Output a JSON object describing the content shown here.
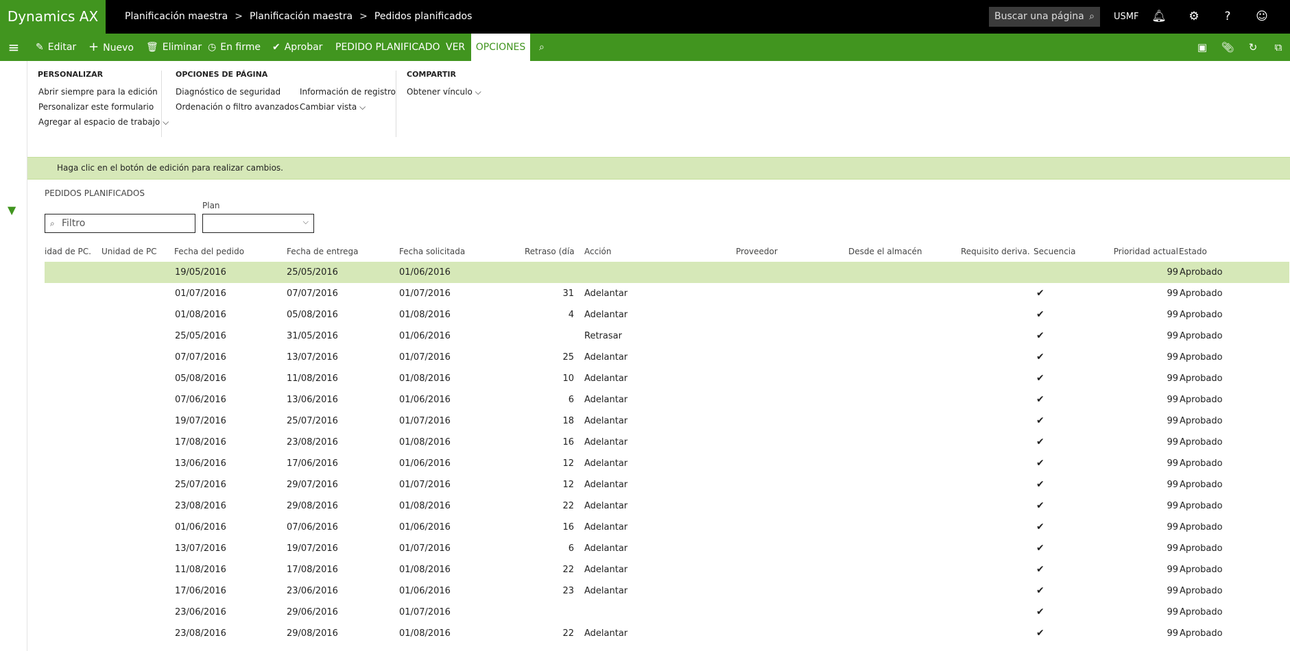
{
  "app": {
    "brand": "Dynamics AX"
  },
  "breadcrumb": [
    "Planificación maestra",
    "Planificación maestra",
    "Pedidos planificados"
  ],
  "search": {
    "placeholder": "Buscar una página",
    "icon": "search-icon"
  },
  "company": "USMF",
  "top_icons": [
    "bell-icon",
    "gear-icon",
    "help-icon",
    "smiley-icon"
  ],
  "actionbar": {
    "edit": "Editar",
    "new": "Nuevo",
    "delete": "Eliminar",
    "firm": "En firme",
    "approve": "Aprobar",
    "tab_order": "PEDIDO PLANIFICADO",
    "tab_view": "VER",
    "tab_options": "OPCIONES"
  },
  "ribbon": {
    "personalizar": {
      "title": "PERSONALIZAR",
      "items": [
        "Abrir siempre para la edición",
        "Personalizar este formulario",
        "Agregar al espacio de trabajo"
      ]
    },
    "opciones": {
      "title": "OPCIONES DE PÁGINA",
      "col1": [
        "Diagnóstico de seguridad",
        "Ordenación o filtro avanzados"
      ],
      "col2": [
        "Información de registro",
        "Cambiar vista"
      ]
    },
    "compartir": {
      "title": "COMPARTIR",
      "items": [
        "Obtener vínculo"
      ]
    }
  },
  "info": "Haga clic en el botón de edición para realizar cambios.",
  "section_title": "PEDIDOS PLANIFICADOS",
  "filter": {
    "placeholder": "Filtro"
  },
  "plan": {
    "label": "Plan",
    "value": ""
  },
  "columns": [
    "idad de PC...",
    "Unidad de PC",
    "Fecha del pedido",
    "Fecha de entrega",
    "Fecha solicitada",
    "Retraso (días)",
    "Acción",
    "Proveedor",
    "Desde el almacén",
    "Requisito deriva...",
    "Secuencia",
    "Prioridad actual",
    "Estado"
  ],
  "rows": [
    {
      "fp": "19/05/2016",
      "fe": "25/05/2016",
      "fs": "01/06/2016",
      "ret": "",
      "acc": "",
      "sec": "",
      "pri": "99",
      "est": "Aprobado"
    },
    {
      "fp": "01/07/2016",
      "fe": "07/07/2016",
      "fs": "01/07/2016",
      "ret": "31",
      "acc": "Adelantar",
      "sec": "✔",
      "pri": "99",
      "est": "Aprobado"
    },
    {
      "fp": "01/08/2016",
      "fe": "05/08/2016",
      "fs": "01/08/2016",
      "ret": "4",
      "acc": "Adelantar",
      "sec": "✔",
      "pri": "99",
      "est": "Aprobado"
    },
    {
      "fp": "25/05/2016",
      "fe": "31/05/2016",
      "fs": "01/06/2016",
      "ret": "",
      "acc": "Retrasar",
      "sec": "✔",
      "pri": "99",
      "est": "Aprobado"
    },
    {
      "fp": "07/07/2016",
      "fe": "13/07/2016",
      "fs": "01/07/2016",
      "ret": "25",
      "acc": "Adelantar",
      "sec": "✔",
      "pri": "99",
      "est": "Aprobado"
    },
    {
      "fp": "05/08/2016",
      "fe": "11/08/2016",
      "fs": "01/08/2016",
      "ret": "10",
      "acc": "Adelantar",
      "sec": "✔",
      "pri": "99",
      "est": "Aprobado"
    },
    {
      "fp": "07/06/2016",
      "fe": "13/06/2016",
      "fs": "01/06/2016",
      "ret": "6",
      "acc": "Adelantar",
      "sec": "✔",
      "pri": "99",
      "est": "Aprobado"
    },
    {
      "fp": "19/07/2016",
      "fe": "25/07/2016",
      "fs": "01/07/2016",
      "ret": "18",
      "acc": "Adelantar",
      "sec": "✔",
      "pri": "99",
      "est": "Aprobado"
    },
    {
      "fp": "17/08/2016",
      "fe": "23/08/2016",
      "fs": "01/08/2016",
      "ret": "16",
      "acc": "Adelantar",
      "sec": "✔",
      "pri": "99",
      "est": "Aprobado"
    },
    {
      "fp": "13/06/2016",
      "fe": "17/06/2016",
      "fs": "01/06/2016",
      "ret": "12",
      "acc": "Adelantar",
      "sec": "✔",
      "pri": "99",
      "est": "Aprobado"
    },
    {
      "fp": "25/07/2016",
      "fe": "29/07/2016",
      "fs": "01/07/2016",
      "ret": "12",
      "acc": "Adelantar",
      "sec": "✔",
      "pri": "99",
      "est": "Aprobado"
    },
    {
      "fp": "23/08/2016",
      "fe": "29/08/2016",
      "fs": "01/08/2016",
      "ret": "22",
      "acc": "Adelantar",
      "sec": "✔",
      "pri": "99",
      "est": "Aprobado"
    },
    {
      "fp": "01/06/2016",
      "fe": "07/06/2016",
      "fs": "01/06/2016",
      "ret": "16",
      "acc": "Adelantar",
      "sec": "✔",
      "pri": "99",
      "est": "Aprobado"
    },
    {
      "fp": "13/07/2016",
      "fe": "19/07/2016",
      "fs": "01/07/2016",
      "ret": "6",
      "acc": "Adelantar",
      "sec": "✔",
      "pri": "99",
      "est": "Aprobado"
    },
    {
      "fp": "11/08/2016",
      "fe": "17/08/2016",
      "fs": "01/08/2016",
      "ret": "22",
      "acc": "Adelantar",
      "sec": "✔",
      "pri": "99",
      "est": "Aprobado"
    },
    {
      "fp": "17/06/2016",
      "fe": "23/06/2016",
      "fs": "01/06/2016",
      "ret": "23",
      "acc": "Adelantar",
      "sec": "✔",
      "pri": "99",
      "est": "Aprobado"
    },
    {
      "fp": "23/06/2016",
      "fe": "29/06/2016",
      "fs": "01/07/2016",
      "ret": "",
      "acc": "",
      "sec": "✔",
      "pri": "99",
      "est": "Aprobado"
    },
    {
      "fp": "23/08/2016",
      "fe": "29/08/2016",
      "fs": "01/08/2016",
      "ret": "22",
      "acc": "Adelantar",
      "sec": "✔",
      "pri": "99",
      "est": "Aprobado"
    }
  ],
  "colors": {
    "accent": "#41951f",
    "selected_row": "#d6e8b8",
    "topbar": "#000000"
  }
}
